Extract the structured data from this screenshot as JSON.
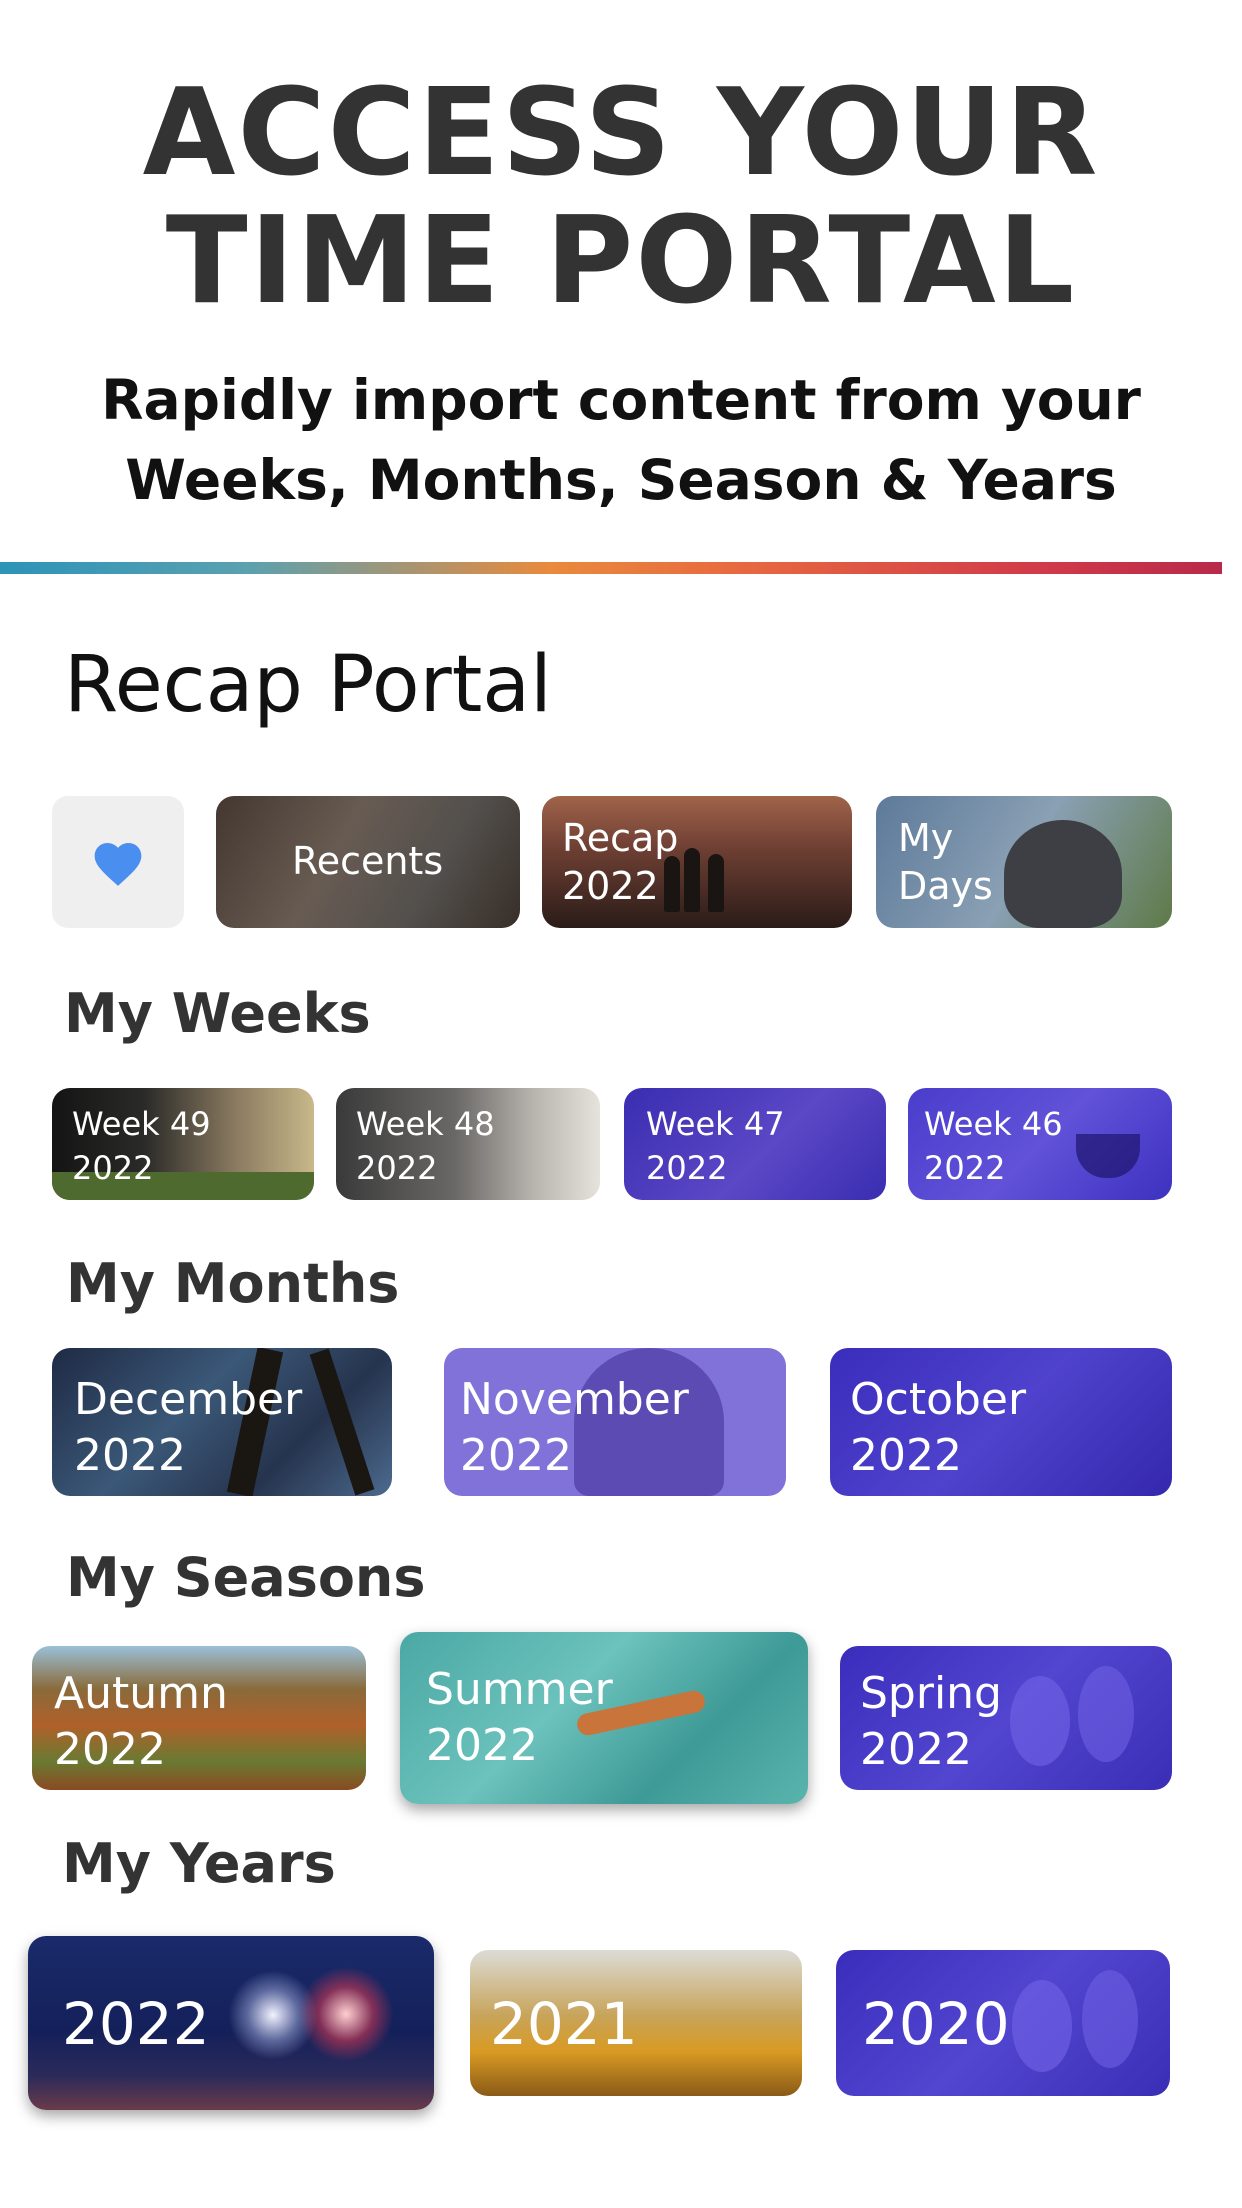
{
  "header": {
    "headline_line1": "ACCESS YOUR",
    "headline_line2": "TIME PORTAL",
    "subhead_line1": "Rapidly import content from your",
    "subhead_line2": "Weeks, Months, Season & Years"
  },
  "portal": {
    "title": "Recap Portal",
    "favorites_icon": "heart-icon",
    "quick": [
      {
        "label": "Recents"
      },
      {
        "label": "Recap\n2022"
      },
      {
        "label": "My\nDays"
      }
    ]
  },
  "weeks": {
    "title": "My Weeks",
    "items": [
      {
        "label": "Week 49\n2022"
      },
      {
        "label": "Week 48\n2022"
      },
      {
        "label": "Week 47\n2022"
      },
      {
        "label": "Week 46\n2022"
      }
    ]
  },
  "months": {
    "title": "My Months",
    "items": [
      {
        "label": "December\n2022"
      },
      {
        "label": "November\n2022"
      },
      {
        "label": "October\n2022"
      }
    ]
  },
  "seasons": {
    "title": "My Seasons",
    "items": [
      {
        "label": "Autumn\n2022"
      },
      {
        "label": "Summer\n2022"
      },
      {
        "label": "Spring\n2022"
      }
    ]
  },
  "years": {
    "title": "My Years",
    "items": [
      {
        "label": "2022"
      },
      {
        "label": "2021"
      },
      {
        "label": "2020"
      }
    ]
  },
  "colors": {
    "heart": "#4a8ff0",
    "purple_overlay": "#3b2fb8",
    "lavender_overlay": "#7e6fd6",
    "headline": "#333333"
  }
}
